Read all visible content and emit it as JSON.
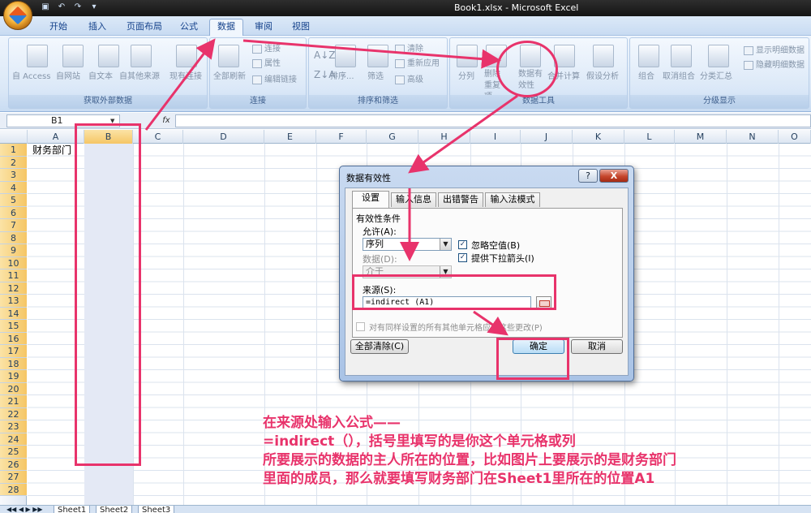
{
  "window": {
    "title": "Book1.xlsx - Microsoft Excel"
  },
  "tabs": [
    "开始",
    "插入",
    "页面布局",
    "公式",
    "数据",
    "审阅",
    "视图"
  ],
  "active_tab": "数据",
  "ribbon": {
    "groups": [
      {
        "label": "获取外部数据",
        "buttons": [
          "自 Access",
          "自网站",
          "自文本",
          "自其他来源",
          "现有连接"
        ]
      },
      {
        "label": "连接",
        "buttons": [
          "全部刷新",
          "连接",
          "属性",
          "编辑链接"
        ]
      },
      {
        "label": "排序和筛选",
        "buttons": [
          "排序...",
          "筛选",
          "清除",
          "重新应用",
          "高级"
        ]
      },
      {
        "label": "数据工具",
        "buttons": [
          "分列",
          "删除重复项",
          "数据有效性",
          "合并计算",
          "假设分析"
        ]
      },
      {
        "label": "分级显示",
        "buttons": [
          "组合",
          "取消组合",
          "分类汇总",
          "显示明细数据",
          "隐藏明细数据"
        ]
      }
    ]
  },
  "formula_bar": {
    "name_box": "B1",
    "fx": "fx",
    "value": ""
  },
  "grid": {
    "columns": [
      "A",
      "B",
      "C",
      "D",
      "E",
      "F",
      "G",
      "H",
      "I",
      "J",
      "K",
      "L",
      "M",
      "N",
      "O"
    ],
    "rows": [
      "1",
      "2",
      "3",
      "4",
      "5",
      "6",
      "7",
      "8",
      "9",
      "10",
      "11",
      "12",
      "13",
      "14",
      "15",
      "16",
      "17",
      "18",
      "19",
      "20",
      "21",
      "22",
      "23",
      "24",
      "25",
      "26",
      "27",
      "28"
    ],
    "cell_a1": "财务部门",
    "selected_column": "B"
  },
  "sheets": [
    "Sheet1",
    "Sheet2",
    "Sheet3"
  ],
  "dialog": {
    "title": "数据有效性",
    "help": "?",
    "close": "X",
    "tabs": [
      "设置",
      "输入信息",
      "出错警告",
      "输入法模式"
    ],
    "criteria_label": "有效性条件",
    "allow_label": "允许(A):",
    "allow_value": "序列",
    "data_label": "数据(D):",
    "data_value": "介于",
    "ignore_blank": "忽略空值(B)",
    "dropdown": "提供下拉箭头(I)",
    "source_label": "来源(S):",
    "source_value": "=indirect (A1)",
    "apply_all": "对有同样设置的所有其他单元格应用这些更改(P)",
    "clear_all": "全部清除(C)",
    "ok": "确定",
    "cancel": "取消"
  },
  "annotation": {
    "lines": [
      "在来源处输入公式——",
      "=indirect（），括号里填写的是你这个单元格或列",
      "所要展示的数据的主人所在的位置，比如图片上要展示的是财务部门",
      "里面的成员，那么就要填写财务部门在Sheet1里所在的位置A1"
    ]
  },
  "colors": {
    "annotation": "#e8336b",
    "ribbon": "#dbe8f7",
    "selection": "#f5c665"
  }
}
